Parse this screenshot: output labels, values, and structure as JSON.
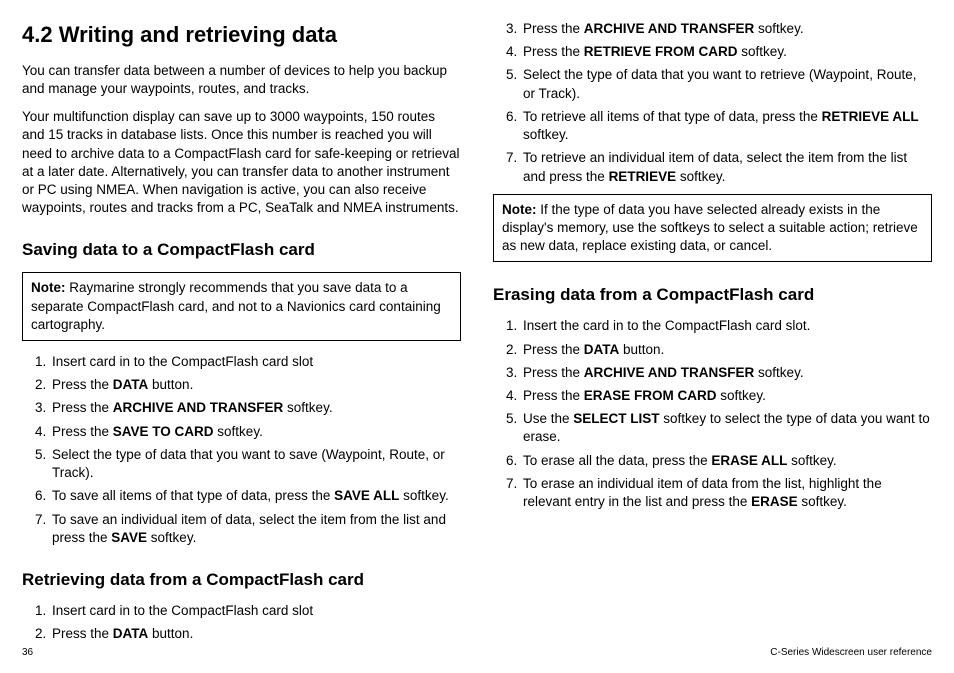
{
  "title": "4.2 Writing and retrieving data",
  "intro1": "You can transfer data between a number of devices to help you backup and manage your waypoints, routes, and tracks.",
  "intro2": "Your multifunction display can save up to 3000 waypoints, 150 routes and 15 tracks in database lists. Once this number is reached you will need to archive data to a CompactFlash card for safe-keeping or retrieval at a later date. Alternatively, you can transfer data to another instrument or PC using NMEA. When navigation is active, you can also receive waypoints, routes and tracks from a PC, SeaTalk and NMEA instruments.",
  "saving": {
    "heading": "Saving data to a CompactFlash card",
    "noteLabel": "Note:",
    "noteText": " Raymarine strongly recommends that you save data to a separate CompactFlash card, and not to a Navionics card containing cartography.",
    "s1": "Insert card in to the CompactFlash card slot",
    "s2a": "Press the ",
    "s2b": "DATA",
    "s2c": " button.",
    "s3a": "Press the ",
    "s3b": "ARCHIVE AND TRANSFER",
    "s3c": " softkey.",
    "s4a": "Press the ",
    "s4b": "SAVE TO CARD",
    "s4c": " softkey.",
    "s5": "Select the type of data that you want to save (Waypoint, Route, or Track).",
    "s6a": "To save all items of that type of data, press the ",
    "s6b": "SAVE ALL",
    "s6c": " softkey.",
    "s7a": "To save an individual item of data, select the item from the list and press the ",
    "s7b": "SAVE",
    "s7c": " softkey."
  },
  "retrieving": {
    "heading": "Retrieving data from a CompactFlash card",
    "s1": "Insert card in to the CompactFlash card slot",
    "s2a": "Press the ",
    "s2b": "DATA",
    "s2c": " button.",
    "s3a": "Press the ",
    "s3b": "ARCHIVE AND TRANSFER",
    "s3c": " softkey.",
    "s4a": "Press the ",
    "s4b": "RETRIEVE FROM CARD",
    "s4c": " softkey.",
    "s5": "Select the type of data that you want to retrieve (Waypoint, Route, or Track).",
    "s6a": "To retrieve all items of that type of data, press the ",
    "s6b": "RETRIEVE ALL",
    "s6c": " softkey.",
    "s7a": "To retrieve an individual item of data, select the item from the list and press the ",
    "s7b": "RETRIEVE",
    "s7c": " softkey.",
    "noteLabel": "Note:",
    "noteText": " If the type of data you have selected already exists in the display's memory, use the softkeys to select a suitable action; retrieve as new data, replace existing data, or cancel."
  },
  "erasing": {
    "heading": "Erasing data from a CompactFlash card",
    "s1": "Insert the card in to the CompactFlash card slot.",
    "s2a": "Press the ",
    "s2b": "DATA",
    "s2c": " button.",
    "s3a": "Press the ",
    "s3b": "ARCHIVE AND TRANSFER",
    "s3c": " softkey.",
    "s4a": "Press the ",
    "s4b": "ERASE FROM CARD",
    "s4c": " softkey.",
    "s5a": "Use the ",
    "s5b": "SELECT LIST",
    "s5c": " softkey to select the type of data you want to erase.",
    "s6a": "To erase all the data, press the ",
    "s6b": "ERASE ALL",
    "s6c": " softkey.",
    "s7a": "To erase an individual item of data from the list, highlight the relevant entry in the list and press the ",
    "s7b": "ERASE",
    "s7c": " softkey."
  },
  "footer": {
    "page": "36",
    "ref": "C-Series Widescreen user reference"
  }
}
